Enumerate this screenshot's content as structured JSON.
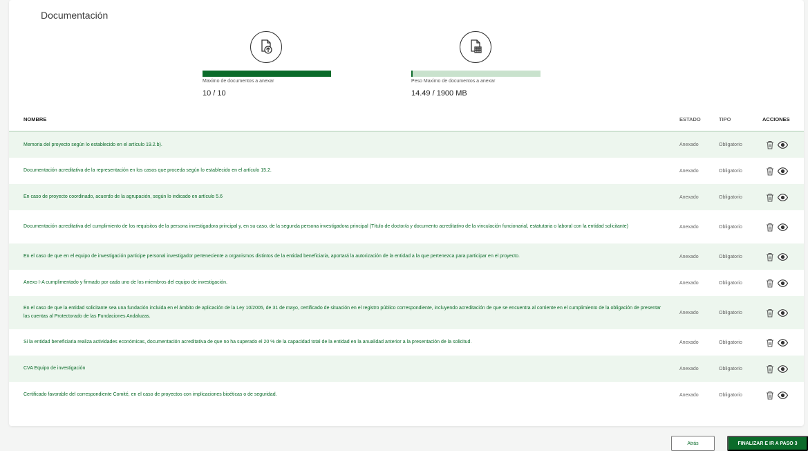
{
  "section": {
    "title": "Documentación"
  },
  "meters": [
    {
      "label": "Maximo de documentos a anexar",
      "value": "10 / 10",
      "fill_fraction": 1.0,
      "icon": "file-upload-icon"
    },
    {
      "label": "Peso Maximo de documentos a anexar",
      "value": "14.49 / 1900 MB",
      "fill_fraction": 0.0076,
      "icon": "file-size-icon"
    }
  ],
  "table": {
    "headers": {
      "name": "NOMBRE",
      "estado": "ESTADO",
      "tipo": "TIPO",
      "acciones": "ACCIONES"
    },
    "rows": [
      {
        "name": "Memoria del proyecto según lo establecido en el artículo 19.2.b).",
        "estado": "Anexado",
        "tipo": "Obligatorio"
      },
      {
        "name": "Documentación acreditativa de la representación en los casos que proceda según lo establecido en el artículo 15.2.",
        "estado": "Anexado",
        "tipo": "Obligatorio"
      },
      {
        "name": "En caso de proyecto coordinado, acuerdo de la agrupación, según lo indicado en artículo 5.6",
        "estado": "Anexado",
        "tipo": "Obligatorio"
      },
      {
        "name": "Documentación acreditativa del cumplimiento de los requisitos de la persona investigadora principal y, en su caso, de la segunda persona investigadora principal (Título de doctor/a y documento acreditativo de la vinculación funcionarial, estatutaria o laboral con la entidad solicitante)",
        "estado": "Anexado",
        "tipo": "Obligatorio"
      },
      {
        "name": "En el caso de que en el equipo de investigación participe personal investigador perteneciente a organismos distintos de la entidad beneficiaria, aportará la autorización de la entidad a la que pertenezca para participar en el proyecto.",
        "estado": "Anexado",
        "tipo": "Obligatorio"
      },
      {
        "name": "Anexo I-A cumplimentado y firmado por cada uno de los miembros del equipo de investigación.",
        "estado": "Anexado",
        "tipo": "Obligatorio"
      },
      {
        "name": "En el caso de que la entidad solicitante sea una fundación incluida en el ámbito de aplicación de la Ley 10/2005, de 31 de mayo, certificado de situación en el registro público correspondiente, incluyendo acreditación de que se encuentra al corriente en el cumplimiento de la obligación de presentar las cuentas al Protectorado de las Fundaciones Andaluzas.",
        "estado": "Anexado",
        "tipo": "Obligatorio"
      },
      {
        "name": "Si la entidad beneficiaria realiza actividades económicas, documentación acreditativa de que no ha superado el 20 % de la capacidad total de la entidad en la anualidad anterior a la presentación de la solicitud.",
        "estado": "Anexado",
        "tipo": "Obligatorio"
      },
      {
        "name": "CVA Equipo de investigación",
        "estado": "Anexado",
        "tipo": "Obligatorio"
      },
      {
        "name": "Certificado favorable del correspondiente Comité, en el caso de proyectos con implicaciones bioéticas o de seguridad.",
        "estado": "Anexado",
        "tipo": "Obligatorio"
      }
    ]
  },
  "actions": {
    "delete_icon": "trash-icon",
    "view_icon": "eye-icon"
  },
  "footer": {
    "back_label": "Atrás",
    "next_label": "FINALIZAR E IR A PASO 3"
  },
  "colors": {
    "brand_green": "#0b6b2a",
    "light_green": "#c9e2cd",
    "row_alt": "#edf6ee"
  }
}
